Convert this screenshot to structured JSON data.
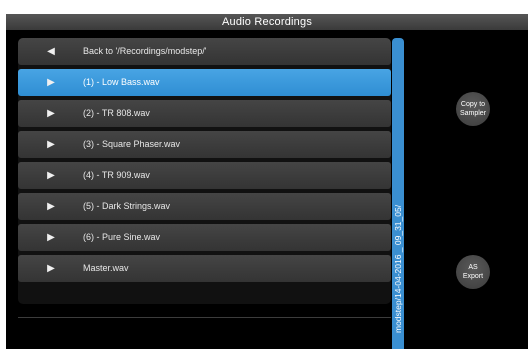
{
  "window": {
    "title": "Audio Recordings"
  },
  "file_list": {
    "back": {
      "icon": "arrow-left-icon",
      "label": "Back to '/Recordings/modstep/'"
    },
    "items": [
      {
        "icon": "play-icon",
        "label": "(1) - Low Bass.wav",
        "selected": true
      },
      {
        "icon": "play-icon",
        "label": "(2) - TR 808.wav",
        "selected": false
      },
      {
        "icon": "play-icon",
        "label": "(3) - Square Phaser.wav",
        "selected": false
      },
      {
        "icon": "play-icon",
        "label": "(4) - TR 909.wav",
        "selected": false
      },
      {
        "icon": "play-icon",
        "label": "(5) - Dark Strings.wav",
        "selected": false
      },
      {
        "icon": "play-icon",
        "label": "(6) - Pure Sine.wav",
        "selected": false
      },
      {
        "icon": "play-icon",
        "label": "Master.wav",
        "selected": false
      }
    ],
    "selected_color": "#3a96d8"
  },
  "scrollbar": {
    "path_label": "modstep/14-04-2016 _ 09_31_05/",
    "color": "#3a8fd1"
  },
  "actions": {
    "copy_to_sampler": "Copy to\nSampler",
    "as_export": "AS\nExport"
  }
}
